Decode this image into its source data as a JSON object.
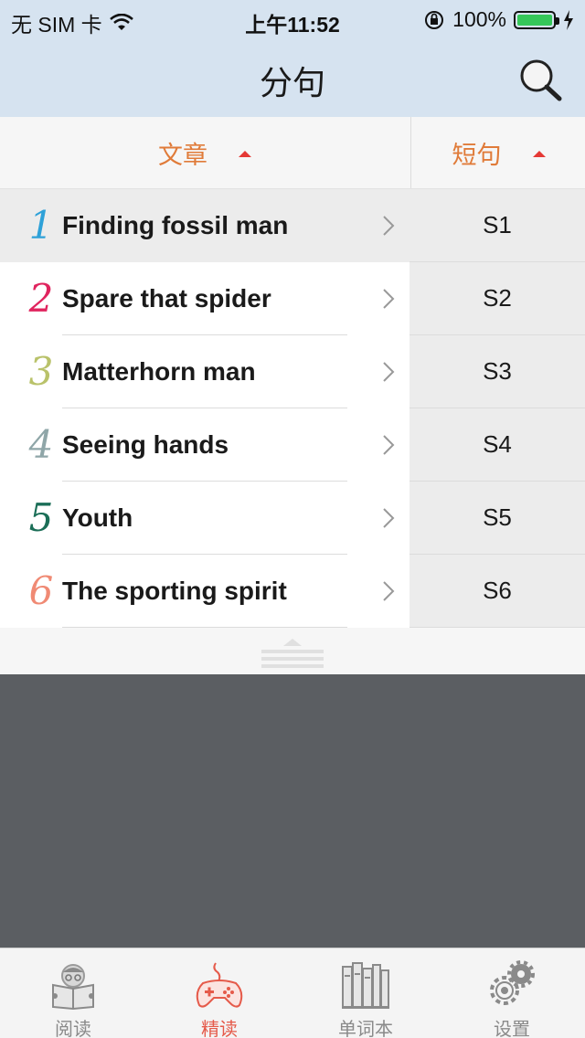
{
  "status": {
    "carrier": "无 SIM 卡",
    "time": "上午11:52",
    "battery": "100%"
  },
  "nav": {
    "title": "分句"
  },
  "header": {
    "articles_label": "文章",
    "sentences_label": "短句"
  },
  "articles": [
    {
      "num": "1",
      "title": "Finding fossil man",
      "color": "#2ea1d8"
    },
    {
      "num": "2",
      "title": "Spare that spider",
      "color": "#e0245e"
    },
    {
      "num": "3",
      "title": "Matterhorn man",
      "color": "#b9c26a"
    },
    {
      "num": "4",
      "title": "Seeing hands",
      "color": "#8fa6a8"
    },
    {
      "num": "5",
      "title": "Youth",
      "color": "#1b6e57"
    },
    {
      "num": "6",
      "title": "The sporting spirit",
      "color": "#f08a74"
    }
  ],
  "sentences": [
    "S1",
    "S2",
    "S3",
    "S4",
    "S5",
    "S6"
  ],
  "tabs": [
    {
      "label": "阅读"
    },
    {
      "label": "精读"
    },
    {
      "label": "单词本"
    },
    {
      "label": "设置"
    }
  ],
  "colors": {
    "accent": "#e07b39",
    "active_tab": "#e55a4a"
  }
}
